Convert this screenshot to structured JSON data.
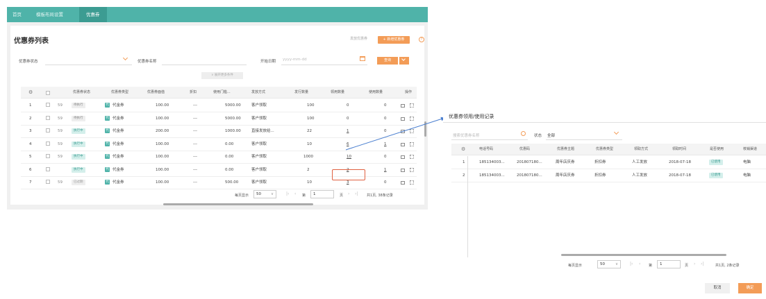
{
  "nav": {
    "tabs": [
      "首页",
      "模板布局设置",
      "优惠券"
    ]
  },
  "main": {
    "title": "优惠券列表",
    "issue_coupon": "发放优惠券",
    "new_coupon": "+ 新增优惠券",
    "help": "?"
  },
  "filters": {
    "status_label": "优惠券状态",
    "name_label": "优惠券名称",
    "date_label": "开始日期",
    "date_placeholder": "yyyy-mm-dd",
    "query": "查询",
    "more": "∨ 展开更多条件"
  },
  "table": {
    "headers": [
      "优惠券状态",
      "优惠券类型",
      "优惠券面值",
      "折扣",
      "使用门槛...",
      "发放方式",
      "发行数量",
      "领用数量",
      "使用数量",
      "操作"
    ],
    "rows": [
      {
        "no": "1",
        "id": "59",
        "status": "待执行",
        "type": "代金券",
        "value": "100.00",
        "discount": "---",
        "threshold": "5000.00",
        "method": "客户领取",
        "issued": "100",
        "claimed": "0",
        "used": "0"
      },
      {
        "no": "2",
        "id": "59",
        "status": "待执行",
        "type": "代金券",
        "value": "100.00",
        "discount": "---",
        "threshold": "5000.00",
        "method": "客户领取",
        "issued": "100",
        "claimed": "0",
        "used": "0"
      },
      {
        "no": "3",
        "id": "59",
        "status": "执行中",
        "type": "代金券",
        "value": "200.00",
        "discount": "---",
        "threshold": "1000.00",
        "method": "直接发放给...",
        "issued": "22",
        "claimed": "1",
        "used": "0"
      },
      {
        "no": "4",
        "id": "59",
        "status": "执行中",
        "type": "代金券",
        "value": "100.00",
        "discount": "---",
        "threshold": "0.00",
        "method": "客户领取",
        "issued": "10",
        "claimed": "6",
        "used": "1"
      },
      {
        "no": "5",
        "id": "59",
        "status": "执行中",
        "type": "代金券",
        "value": "100.00",
        "discount": "---",
        "threshold": "0.00",
        "method": "客户领取",
        "issued": "1000",
        "claimed": "10",
        "used": "0"
      },
      {
        "no": "6",
        "id": "",
        "status": "执行中",
        "type": "代金券",
        "value": "100.00",
        "discount": "---",
        "threshold": "0.00",
        "method": "客户领取",
        "issued": "2",
        "claimed": "2",
        "used": "1"
      },
      {
        "no": "7",
        "id": "59",
        "status": "已过期",
        "type": "代金券",
        "value": "100.00",
        "discount": "---",
        "threshold": "500.00",
        "method": "客户领取",
        "issued": "10",
        "claimed": "3",
        "used": "0"
      }
    ],
    "type_glyph": "代"
  },
  "pager1": {
    "per_page_label": "每页显示",
    "per_page": "50",
    "page_prefix": "第",
    "page": "1",
    "page_suffix": "页",
    "summary": "共1页, 38条记录"
  },
  "dialog": {
    "title": "优惠券领用/使用记录",
    "search_placeholder": "搜索优惠券名称",
    "status_label": "状态",
    "status_value": "全部",
    "headers": [
      "电话号码",
      "优惠码",
      "优惠券主题",
      "优惠券类型",
      "领取方式",
      "领取时间",
      "是否使用",
      "核销渠道"
    ],
    "rows": [
      {
        "no": "1",
        "phone": "185134003...",
        "code": "201807180...",
        "theme": "周年店庆券",
        "type": "折扣券",
        "method": "人工发放",
        "time": "2018-07-18",
        "used": "已使用",
        "channel": "电脑"
      },
      {
        "no": "2",
        "phone": "185134003...",
        "code": "201807180...",
        "theme": "周年店庆券",
        "type": "折扣券",
        "method": "人工发放",
        "time": "2018-07-18",
        "used": "已使用",
        "channel": "电脑"
      }
    ],
    "pager": {
      "per_page_label": "每页显示",
      "per_page": "50",
      "page_prefix": "第",
      "page": "1",
      "page_suffix": "页",
      "summary": "共1页, 2条记录"
    },
    "cancel": "取消",
    "ok": "确定"
  },
  "colors": {
    "nav": "#4fb3a9",
    "accent": "#f39c57",
    "highlight": "#e06040",
    "connector": "#4a7fd0"
  }
}
